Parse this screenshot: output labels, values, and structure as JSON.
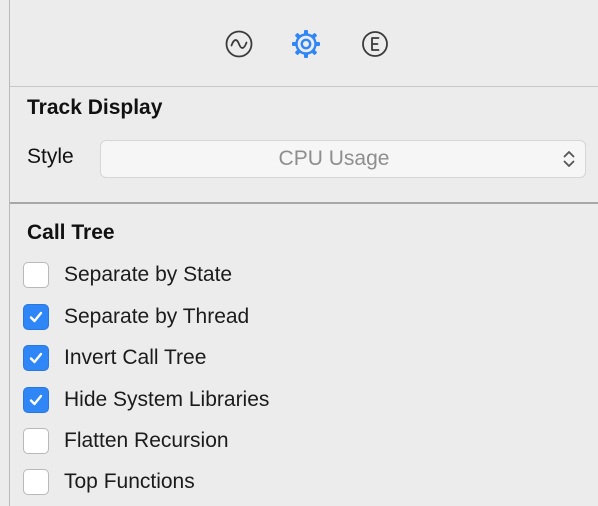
{
  "toolbar": {
    "icons": [
      {
        "name": "waveform-icon",
        "active": false
      },
      {
        "name": "gear-icon",
        "active": true
      },
      {
        "name": "extended-detail-icon",
        "active": false
      }
    ],
    "active_color": "#2f86f6",
    "inactive_color": "#3a3a3a"
  },
  "track_display": {
    "title": "Track Display",
    "style_label": "Style",
    "style_value": "CPU Usage"
  },
  "call_tree": {
    "title": "Call Tree",
    "options": [
      {
        "label": "Separate by State",
        "checked": false
      },
      {
        "label": "Separate by Thread",
        "checked": true
      },
      {
        "label": "Invert Call Tree",
        "checked": true
      },
      {
        "label": "Hide System Libraries",
        "checked": true
      },
      {
        "label": "Flatten Recursion",
        "checked": false
      },
      {
        "label": "Top Functions",
        "checked": false
      }
    ]
  },
  "colors": {
    "checkbox_accent": "#2f86f6",
    "panel_background": "#ececec"
  }
}
